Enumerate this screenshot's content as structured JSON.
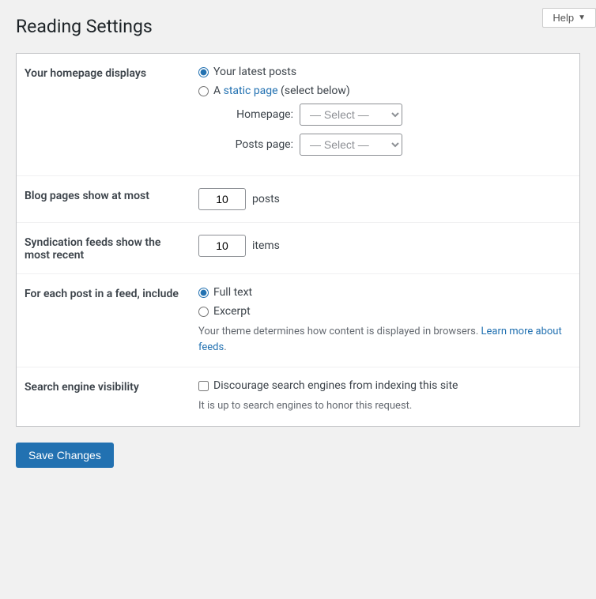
{
  "page": {
    "title": "Reading Settings",
    "help_label": "Help"
  },
  "sections": [
    {
      "id": "homepage-displays",
      "label": "Your homepage displays",
      "type": "radio-with-selects",
      "options": [
        {
          "id": "latest-posts",
          "label": "Your latest posts",
          "checked": true
        },
        {
          "id": "static-page",
          "label_prefix": "A ",
          "link_text": "static page",
          "label_suffix": " (select below)",
          "checked": false
        }
      ],
      "selects": [
        {
          "label": "Homepage:",
          "placeholder": "— Select —"
        },
        {
          "label": "Posts page:",
          "placeholder": "— Select —"
        }
      ]
    },
    {
      "id": "blog-pages",
      "label": "Blog pages show at most",
      "type": "number",
      "value": "10",
      "suffix": "posts"
    },
    {
      "id": "syndication-feeds",
      "label": "Syndication feeds show the most recent",
      "type": "number",
      "value": "10",
      "suffix": "items"
    },
    {
      "id": "feed-include",
      "label": "For each post in a feed, include",
      "type": "radio-with-description",
      "options": [
        {
          "id": "full-text",
          "label": "Full text",
          "checked": true
        },
        {
          "id": "excerpt",
          "label": "Excerpt",
          "checked": false
        }
      ],
      "description_prefix": "Your theme determines how content is displayed in browsers. ",
      "link_text": "Learn more about feeds",
      "description_suffix": "."
    },
    {
      "id": "search-visibility",
      "label": "Search engine visibility",
      "type": "checkbox-with-description",
      "checkbox_label": "Discourage search engines from indexing this site",
      "description": "It is up to search engines to honor this request."
    }
  ],
  "save_button": {
    "label": "Save Changes"
  }
}
